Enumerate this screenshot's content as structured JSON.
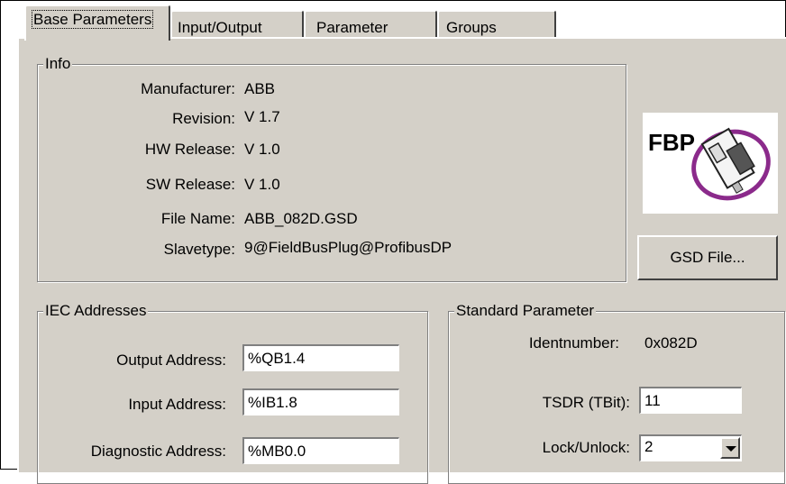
{
  "tabs": [
    {
      "label": "Base Parameters",
      "active": true
    },
    {
      "label": "Input/Output",
      "active": false
    },
    {
      "label": "Parameter",
      "active": false
    },
    {
      "label": "Groups",
      "active": false
    }
  ],
  "info": {
    "legend": "Info",
    "rows": [
      {
        "label": "Manufacturer:",
        "value": "ABB"
      },
      {
        "label": "Revision:",
        "value": "V 1.7"
      },
      {
        "label": "HW Release:",
        "value": "V 1.0"
      },
      {
        "label": "SW Release:",
        "value": "V 1.0"
      },
      {
        "label": "File Name:",
        "value": "ABB_082D.GSD"
      },
      {
        "label": "Slavetype:",
        "value": "9@FieldBusPlug@ProfibusDP"
      }
    ]
  },
  "logo": {
    "text": "FBP",
    "icon": "fieldbusplug-logo-icon",
    "accent_color": "#8b2a8b"
  },
  "gsd_button_label": "GSD File...",
  "iec": {
    "legend": "IEC Addresses",
    "output_label": "Output Address:",
    "output_value": "%QB1.4",
    "input_label": "Input Address:",
    "input_value": "%IB1.8",
    "diag_label": "Diagnostic Address:",
    "diag_value": "%MB0.0"
  },
  "standard": {
    "legend": "Standard Parameter",
    "ident_label": "Identnumber:",
    "ident_value": "0x082D",
    "tsdr_label": "TSDR (TBit):",
    "tsdr_value": "11",
    "lock_label": "Lock/Unlock:",
    "lock_value": "2"
  },
  "colors": {
    "panel": "#d4d0c8",
    "shadow": "#808080",
    "highlight": "#ffffff"
  }
}
